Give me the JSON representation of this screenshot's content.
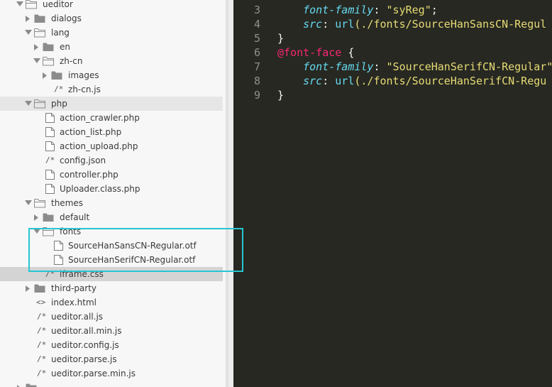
{
  "sidebar": {
    "items": [
      {
        "label": "ueditor",
        "depth": 0,
        "type": "folder",
        "expanded": true
      },
      {
        "label": "dialogs",
        "depth": 1,
        "type": "folder",
        "expanded": false
      },
      {
        "label": "lang",
        "depth": 1,
        "type": "folder",
        "expanded": true
      },
      {
        "label": "en",
        "depth": 2,
        "type": "folder",
        "expanded": false
      },
      {
        "label": "zh-cn",
        "depth": 2,
        "type": "folder",
        "expanded": true
      },
      {
        "label": "images",
        "depth": 3,
        "type": "folder",
        "expanded": false
      },
      {
        "label": "zh-cn.js",
        "depth": 3,
        "type": "comment-file"
      },
      {
        "label": "php",
        "depth": 1,
        "type": "folder",
        "expanded": true
      },
      {
        "label": "action_crawler.php",
        "depth": 2,
        "type": "file"
      },
      {
        "label": "action_list.php",
        "depth": 2,
        "type": "file"
      },
      {
        "label": "action_upload.php",
        "depth": 2,
        "type": "file"
      },
      {
        "label": "config.json",
        "depth": 2,
        "type": "comment-file"
      },
      {
        "label": "controller.php",
        "depth": 2,
        "type": "file"
      },
      {
        "label": "Uploader.class.php",
        "depth": 2,
        "type": "file"
      },
      {
        "label": "themes",
        "depth": 1,
        "type": "folder",
        "expanded": true
      },
      {
        "label": "default",
        "depth": 2,
        "type": "folder",
        "expanded": false
      },
      {
        "label": "fonts",
        "depth": 2,
        "type": "folder",
        "expanded": true
      },
      {
        "label": "SourceHanSansCN-Regular.otf",
        "depth": 3,
        "type": "file"
      },
      {
        "label": "SourceHanSerifCN-Regular.otf",
        "depth": 3,
        "type": "file"
      },
      {
        "label": "iframe.css",
        "depth": 2,
        "type": "comment-file"
      },
      {
        "label": "third-party",
        "depth": 1,
        "type": "folder",
        "expanded": false
      },
      {
        "label": "index.html",
        "depth": 1,
        "type": "code-file"
      },
      {
        "label": "ueditor.all.js",
        "depth": 1,
        "type": "comment-file"
      },
      {
        "label": "ueditor.all.min.js",
        "depth": 1,
        "type": "comment-file"
      },
      {
        "label": "ueditor.config.js",
        "depth": 1,
        "type": "comment-file"
      },
      {
        "label": "ueditor.parse.js",
        "depth": 1,
        "type": "comment-file"
      },
      {
        "label": "ueditor.parse.min.js",
        "depth": 1,
        "type": "comment-file"
      },
      {
        "label": "",
        "depth": 0,
        "type": "folder",
        "expanded": false
      }
    ],
    "selected_label": "iframe.css"
  },
  "editor": {
    "lines": [
      {
        "num": "3",
        "tokens": [
          {
            "t": "    ",
            "c": "punct"
          },
          {
            "t": "font-family",
            "c": "prop"
          },
          {
            "t": ": ",
            "c": "punct"
          },
          {
            "t": "\"syReg\"",
            "c": "str"
          },
          {
            "t": ";",
            "c": "punct"
          }
        ]
      },
      {
        "num": "4",
        "tokens": [
          {
            "t": "    ",
            "c": "punct"
          },
          {
            "t": "src",
            "c": "prop"
          },
          {
            "t": ": ",
            "c": "punct"
          },
          {
            "t": "url",
            "c": "fn"
          },
          {
            "t": "(./fonts/SourceHanSansCN-Regul",
            "c": "str"
          }
        ]
      },
      {
        "num": "5",
        "tokens": [
          {
            "t": "}",
            "c": "punct"
          }
        ]
      },
      {
        "num": "6",
        "tokens": [
          {
            "t": "@font-face",
            "c": "kw-at"
          },
          {
            "t": " {",
            "c": "punct"
          }
        ]
      },
      {
        "num": "7",
        "tokens": [
          {
            "t": "    ",
            "c": "punct"
          },
          {
            "t": "font-family",
            "c": "prop"
          },
          {
            "t": ": ",
            "c": "punct"
          },
          {
            "t": "\"SourceHanSerifCN-Regular\"",
            "c": "str"
          }
        ]
      },
      {
        "num": "8",
        "tokens": [
          {
            "t": "    ",
            "c": "punct"
          },
          {
            "t": "src",
            "c": "prop"
          },
          {
            "t": ": ",
            "c": "punct"
          },
          {
            "t": "url",
            "c": "fn"
          },
          {
            "t": "(./fonts/SourceHanSerifCN-Regu",
            "c": "str"
          }
        ]
      },
      {
        "num": "9",
        "tokens": [
          {
            "t": "}",
            "c": "punct"
          }
        ]
      }
    ]
  },
  "colors": {
    "editor_bg": "#272822",
    "sidebar_bg": "#f7f7f7",
    "highlight": "#26c6d0",
    "selected_row": "#d4d4d4"
  }
}
